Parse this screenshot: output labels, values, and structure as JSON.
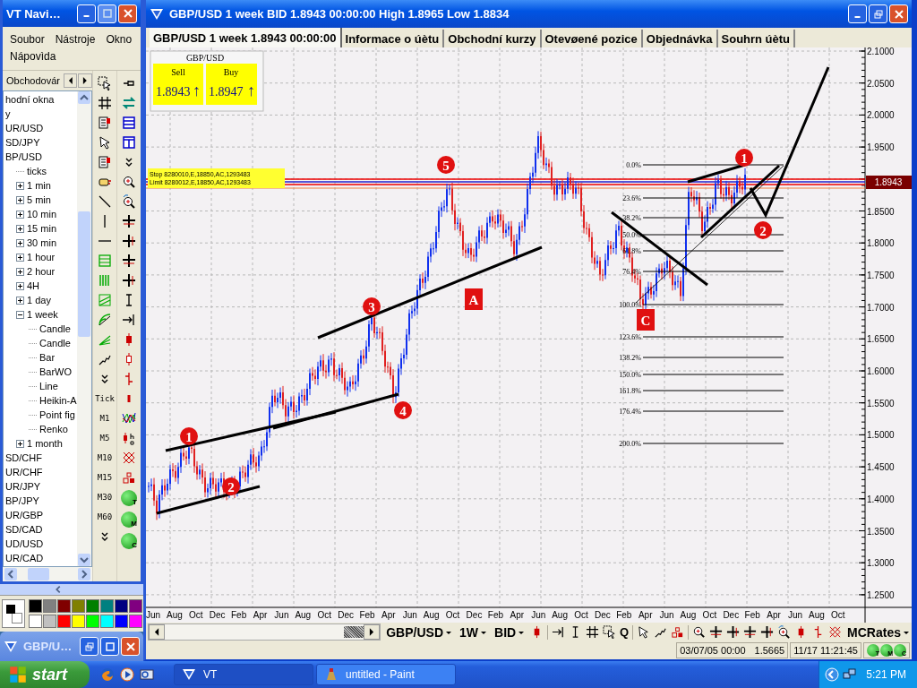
{
  "navigator": {
    "title": "VT Navi…",
    "menu": [
      "Soubor",
      "Nástroje",
      "Okno",
      "Nápovìda"
    ],
    "tab": "Obchodovár",
    "tree": [
      {
        "label": "hodní okna"
      },
      {
        "label": "y"
      },
      {
        "label": "UR/USD"
      },
      {
        "label": "SD/JPY"
      },
      {
        "label": "BP/USD",
        "children": [
          {
            "label": "ticks"
          },
          {
            "label": "1 min",
            "expanded": false
          },
          {
            "label": "5 min",
            "expanded": false
          },
          {
            "label": "10 min",
            "expanded": false
          },
          {
            "label": "15 min",
            "expanded": false
          },
          {
            "label": "30 min",
            "expanded": false
          },
          {
            "label": "1 hour",
            "expanded": false
          },
          {
            "label": "2 hour",
            "expanded": false
          },
          {
            "label": "4H",
            "expanded": false
          },
          {
            "label": "1 day",
            "expanded": false
          },
          {
            "label": "1 week",
            "expanded": true,
            "children": [
              {
                "label": "Candle"
              },
              {
                "label": "Candle"
              },
              {
                "label": "Bar"
              },
              {
                "label": "BarWO"
              },
              {
                "label": "Line"
              },
              {
                "label": "Heikin-A"
              },
              {
                "label": "Point fig"
              },
              {
                "label": "Renko"
              }
            ]
          },
          {
            "label": "1 month",
            "expanded": false
          }
        ]
      },
      {
        "label": "SD/CHF"
      },
      {
        "label": "UR/CHF"
      },
      {
        "label": "UR/JPY"
      },
      {
        "label": "BP/JPY"
      },
      {
        "label": "UR/GBP"
      },
      {
        "label": "SD/CAD"
      },
      {
        "label": "UD/USD"
      },
      {
        "label": "UR/CAD"
      }
    ],
    "periods": [
      "Tick",
      "M1",
      "M5",
      "M10",
      "M15",
      "M30",
      "M60"
    ],
    "badges": [
      "T",
      "M",
      "C"
    ]
  },
  "paint": {
    "palette": [
      {
        "color": "#000000"
      },
      {
        "color": "#808080"
      },
      {
        "color": "#800000"
      },
      {
        "color": "#808000"
      },
      {
        "color": "#008000"
      },
      {
        "color": "#008080"
      },
      {
        "color": "#000080"
      },
      {
        "color": "#800080"
      },
      {
        "color": "#ffffff"
      },
      {
        "color": "#c0c0c0"
      },
      {
        "color": "#ff0000"
      },
      {
        "color": "#ffff00"
      },
      {
        "color": "#00ff00"
      },
      {
        "color": "#00ffff"
      },
      {
        "color": "#0000ff"
      },
      {
        "color": "#ff00ff"
      }
    ]
  },
  "minimized_window": {
    "title": "GBP/U…"
  },
  "window": {
    "title": "GBP/USD 1 week BID 1.8943 00:00:00 High 1.8965 Low 1.8834"
  },
  "tabs": [
    {
      "label": "GBP/USD 1 week 1.8943 00:00:00",
      "selected": true
    },
    {
      "label": "Informace o úètu",
      "selected": false
    },
    {
      "label": "Obchodní kurzy",
      "selected": false
    },
    {
      "label": "Otevøené pozice",
      "selected": false
    },
    {
      "label": "Objednávka",
      "selected": false
    },
    {
      "label": "Souhrn úètu",
      "selected": false
    }
  ],
  "quote": {
    "symbol": "GBP/USD",
    "sell_label": "Sell",
    "buy_label": "Buy",
    "sell": "1.8943",
    "sell_arrow": "↑",
    "buy": "1.8947",
    "buy_arrow": "↑"
  },
  "chart": {
    "orders": [
      "Stop 8280010,E,18850,AC,1293483",
      "Limit 8280012,E,18850,AC,1293483"
    ],
    "price_tag": "1.8943",
    "y_axis": [
      "2.1000",
      "2.0500",
      "2.0000",
      "1.9500",
      "1.8500",
      "1.8000",
      "1.7500",
      "1.7000",
      "1.6500",
      "1.6000",
      "1.5500",
      "1.5000",
      "1.4500",
      "1.4000",
      "1.3500",
      "1.3000",
      "1.2500"
    ],
    "x_axis": [
      "Jun",
      "Aug",
      "Oct",
      "Dec",
      "Feb",
      "Apr",
      "Jun",
      "Aug",
      "Oct",
      "Dec",
      "Feb",
      "Apr",
      "Jun",
      "Aug",
      "Oct",
      "Dec",
      "Feb",
      "Apr",
      "Jun",
      "Aug",
      "Oct",
      "Dec",
      "Feb",
      "Apr",
      "Jun",
      "Aug",
      "Oct",
      "Dec",
      "Feb",
      "Apr",
      "Jun",
      "Aug",
      "Oct"
    ],
    "fib_levels": [
      "0.0%",
      "23.6%",
      "38.2%",
      "50.0%",
      "61.8%",
      "76.4%",
      "100.0%",
      "123.6%",
      "138.2%",
      "150.0%",
      "161.8%",
      "176.4%",
      "200.0%"
    ],
    "wave_labels": [
      {
        "text": "1",
        "kind": "circle"
      },
      {
        "text": "2",
        "kind": "circle"
      },
      {
        "text": "3",
        "kind": "circle"
      },
      {
        "text": "4",
        "kind": "circle"
      },
      {
        "text": "5",
        "kind": "circle"
      },
      {
        "text": "1",
        "kind": "circle"
      },
      {
        "text": "2",
        "kind": "circle"
      },
      {
        "text": "A",
        "kind": "square"
      },
      {
        "text": "C",
        "kind": "square"
      }
    ]
  },
  "toolbar": {
    "symbol": "GBP/USD",
    "period": "1W",
    "price_type": "BID",
    "quote_button": "Q",
    "source": "MCRates"
  },
  "status": {
    "date": "03/07/05 00:00",
    "price": "1.5665",
    "time": "11/17 11:21:45",
    "badges": [
      "T",
      "M",
      "C"
    ]
  },
  "taskbar": {
    "start": "start",
    "tasks": [
      {
        "label": "VT",
        "selected": true
      },
      {
        "label": "untitled - Paint",
        "selected": false
      }
    ],
    "clock": "5:21 PM"
  }
}
